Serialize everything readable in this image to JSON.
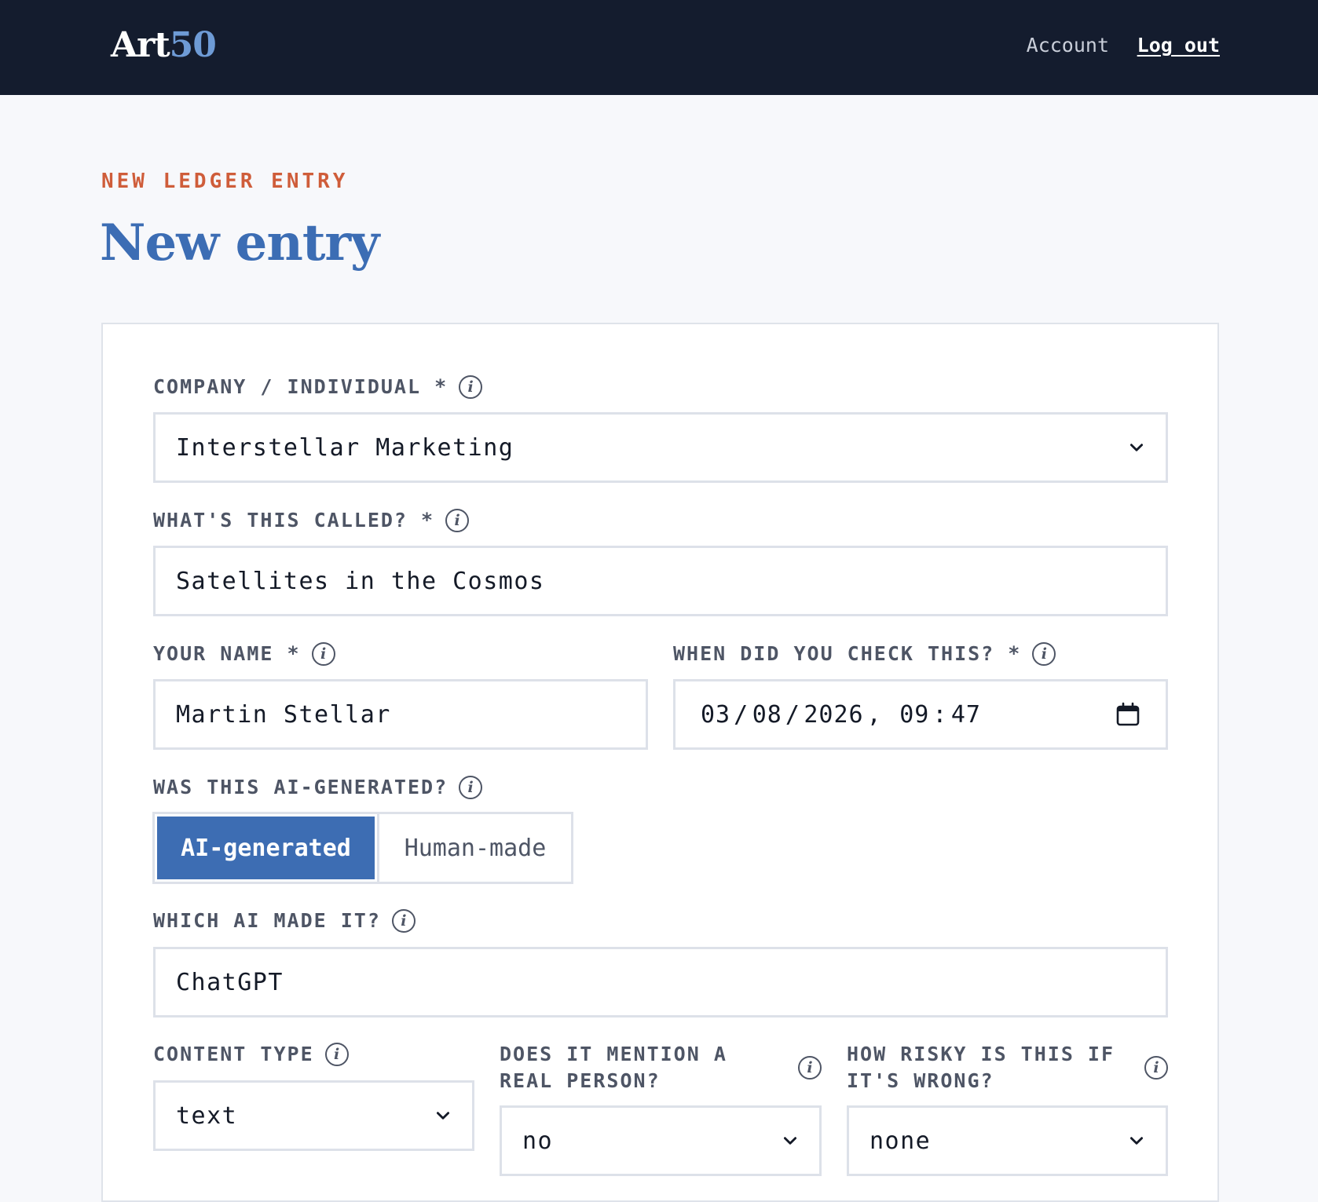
{
  "header": {
    "logo_text": "Art",
    "logo_number": "50",
    "account_label": "Account",
    "logout_label": "Log out"
  },
  "page": {
    "eyebrow": "NEW LEDGER ENTRY",
    "title": "New entry"
  },
  "form": {
    "company": {
      "label": "COMPANY / INDIVIDUAL *",
      "value": "Interstellar Marketing"
    },
    "called": {
      "label": "WHAT'S THIS CALLED? *",
      "value": "Satellites in the Cosmos"
    },
    "your_name": {
      "label": "YOUR NAME *",
      "value": "Martin Stellar"
    },
    "checked_when": {
      "label": "WHEN DID YOU CHECK THIS? *",
      "month": "03",
      "day": "08",
      "year": "2026",
      "hour": "09",
      "minute": "47"
    },
    "ai_generated": {
      "label": "WAS THIS AI-GENERATED?",
      "options": [
        "AI-generated",
        "Human-made"
      ],
      "selected": "AI-generated"
    },
    "which_ai": {
      "label": "WHICH AI MADE IT?",
      "value": "ChatGPT"
    },
    "content_type": {
      "label": "CONTENT TYPE",
      "value": "text"
    },
    "real_person": {
      "label": "DOES IT MENTION A\nREAL PERSON?",
      "value": "no"
    },
    "risk": {
      "label": "HOW RISKY IS THIS IF\nIT'S WRONG?",
      "value": "none"
    }
  },
  "icons": {
    "info": "info-icon",
    "chevron": "chevron-down-icon",
    "calendar": "calendar-icon"
  },
  "colors": {
    "topbar": "#141c2e",
    "accent": "#3d6db3",
    "eyebrow": "#cf5d3a"
  }
}
